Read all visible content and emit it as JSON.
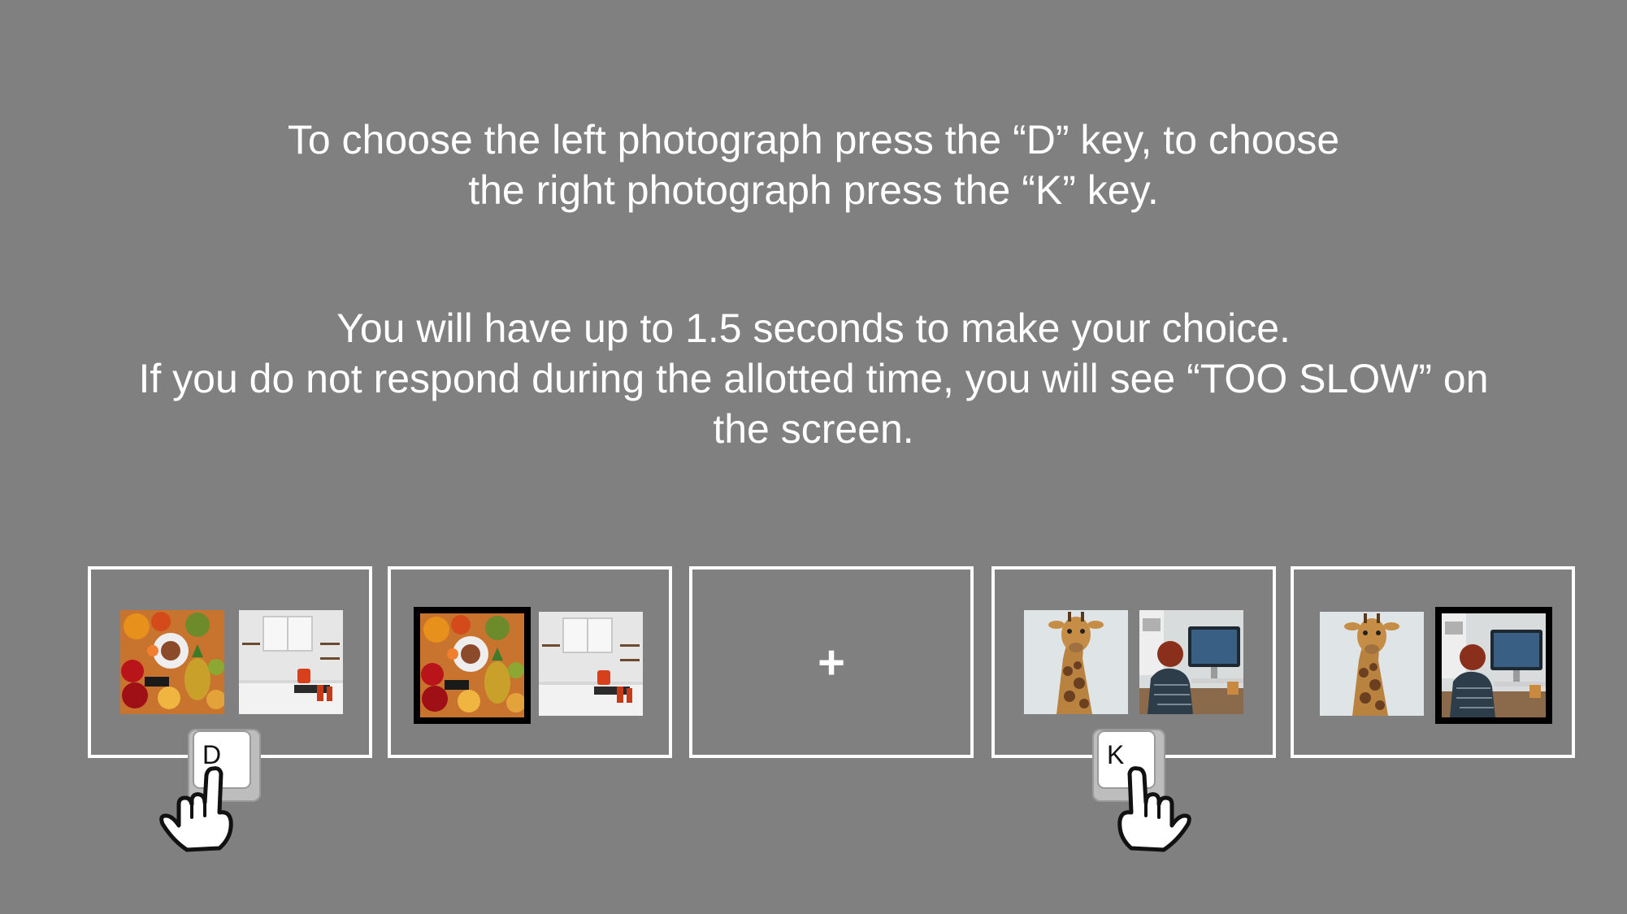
{
  "instructions": {
    "line1": "To choose the left photograph press the “D” key, to choose",
    "line2": "the right photograph press the “K” key.",
    "line3": "You will have up to 1.5 seconds to make your choice.",
    "line4": "If you do not respond during the allotted time, you will see “TOO SLOW” on",
    "line5": "the screen."
  },
  "fixation_symbol": "+",
  "keys": {
    "left": "D",
    "right": "K"
  },
  "colors": {
    "background": "#808080",
    "frame": "#ffffff",
    "selection_border": "#000000"
  },
  "panels": [
    {
      "name": "food-vs-kitchen",
      "left_image": "food-spread-photo",
      "right_image": "kitchen-photo",
      "selected": null
    },
    {
      "name": "food-selected",
      "left_image": "food-spread-photo",
      "right_image": "kitchen-photo",
      "selected": "left"
    },
    {
      "name": "fixation",
      "selected": null
    },
    {
      "name": "giraffe-vs-computer",
      "left_image": "giraffe-photo",
      "right_image": "person-at-computer-photo",
      "selected": null
    },
    {
      "name": "computer-selected",
      "left_image": "giraffe-photo",
      "right_image": "person-at-computer-photo",
      "selected": "right"
    }
  ]
}
